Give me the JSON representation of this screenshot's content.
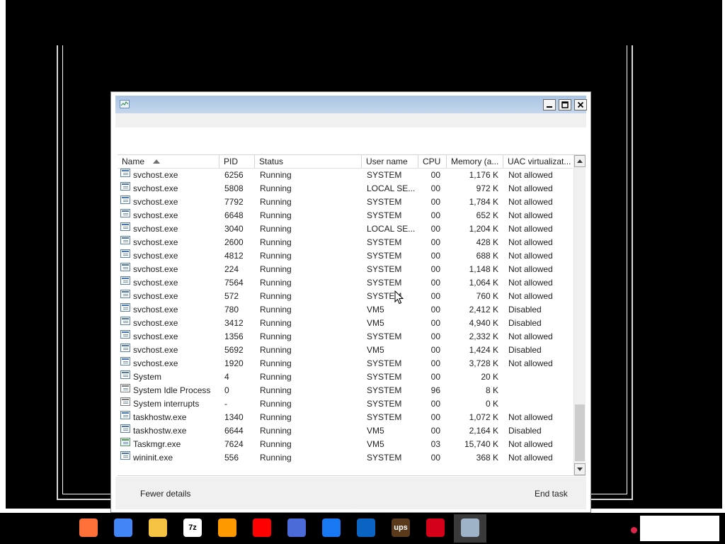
{
  "window": {
    "columns": [
      "Name",
      "PID",
      "Status",
      "User name",
      "CPU",
      "Memory (a...",
      "UAC virtualizat..."
    ],
    "rows": [
      {
        "name": "svchost.exe",
        "pid": "6256",
        "status": "Running",
        "user": "SYSTEM",
        "cpu": "00",
        "mem": "1,176 K",
        "uac": "Not allowed",
        "icon": "service-icon"
      },
      {
        "name": "svchost.exe",
        "pid": "5808",
        "status": "Running",
        "user": "LOCAL SE...",
        "cpu": "00",
        "mem": "972 K",
        "uac": "Not allowed",
        "icon": "service-icon"
      },
      {
        "name": "svchost.exe",
        "pid": "7792",
        "status": "Running",
        "user": "SYSTEM",
        "cpu": "00",
        "mem": "1,784 K",
        "uac": "Not allowed",
        "icon": "service-icon"
      },
      {
        "name": "svchost.exe",
        "pid": "6648",
        "status": "Running",
        "user": "SYSTEM",
        "cpu": "00",
        "mem": "652 K",
        "uac": "Not allowed",
        "icon": "service-icon"
      },
      {
        "name": "svchost.exe",
        "pid": "3040",
        "status": "Running",
        "user": "LOCAL SE...",
        "cpu": "00",
        "mem": "1,204 K",
        "uac": "Not allowed",
        "icon": "service-icon"
      },
      {
        "name": "svchost.exe",
        "pid": "2600",
        "status": "Running",
        "user": "SYSTEM",
        "cpu": "00",
        "mem": "428 K",
        "uac": "Not allowed",
        "icon": "service-icon"
      },
      {
        "name": "svchost.exe",
        "pid": "4812",
        "status": "Running",
        "user": "SYSTEM",
        "cpu": "00",
        "mem": "688 K",
        "uac": "Not allowed",
        "icon": "service-icon"
      },
      {
        "name": "svchost.exe",
        "pid": "224",
        "status": "Running",
        "user": "SYSTEM",
        "cpu": "00",
        "mem": "1,148 K",
        "uac": "Not allowed",
        "icon": "service-icon"
      },
      {
        "name": "svchost.exe",
        "pid": "7564",
        "status": "Running",
        "user": "SYSTEM",
        "cpu": "00",
        "mem": "1,064 K",
        "uac": "Not allowed",
        "icon": "service-icon"
      },
      {
        "name": "svchost.exe",
        "pid": "572",
        "status": "Running",
        "user": "SYSTEM",
        "cpu": "00",
        "mem": "760 K",
        "uac": "Not allowed",
        "icon": "service-icon"
      },
      {
        "name": "svchost.exe",
        "pid": "780",
        "status": "Running",
        "user": "VM5",
        "cpu": "00",
        "mem": "2,412 K",
        "uac": "Disabled",
        "icon": "service-icon"
      },
      {
        "name": "svchost.exe",
        "pid": "3412",
        "status": "Running",
        "user": "VM5",
        "cpu": "00",
        "mem": "4,940 K",
        "uac": "Disabled",
        "icon": "service-icon"
      },
      {
        "name": "svchost.exe",
        "pid": "1356",
        "status": "Running",
        "user": "SYSTEM",
        "cpu": "00",
        "mem": "2,332 K",
        "uac": "Not allowed",
        "icon": "service-icon"
      },
      {
        "name": "svchost.exe",
        "pid": "5692",
        "status": "Running",
        "user": "VM5",
        "cpu": "00",
        "mem": "1,424 K",
        "uac": "Disabled",
        "icon": "service-icon"
      },
      {
        "name": "svchost.exe",
        "pid": "1920",
        "status": "Running",
        "user": "SYSTEM",
        "cpu": "00",
        "mem": "3,728 K",
        "uac": "Not allowed",
        "icon": "service-icon"
      },
      {
        "name": "System",
        "pid": "4",
        "status": "Running",
        "user": "SYSTEM",
        "cpu": "00",
        "mem": "20 K",
        "uac": "",
        "icon": "service-icon"
      },
      {
        "name": "System Idle Process",
        "pid": "0",
        "status": "Running",
        "user": "SYSTEM",
        "cpu": "96",
        "mem": "8 K",
        "uac": "",
        "icon": "system-icon"
      },
      {
        "name": "System interrupts",
        "pid": "-",
        "status": "Running",
        "user": "SYSTEM",
        "cpu": "00",
        "mem": "0 K",
        "uac": "",
        "icon": "system-icon"
      },
      {
        "name": "taskhostw.exe",
        "pid": "1340",
        "status": "Running",
        "user": "SYSTEM",
        "cpu": "00",
        "mem": "1,072 K",
        "uac": "Not allowed",
        "icon": "service-icon"
      },
      {
        "name": "taskhostw.exe",
        "pid": "6644",
        "status": "Running",
        "user": "VM5",
        "cpu": "00",
        "mem": "2,164 K",
        "uac": "Disabled",
        "icon": "service-icon"
      },
      {
        "name": "Taskmgr.exe",
        "pid": "7624",
        "status": "Running",
        "user": "VM5",
        "cpu": "03",
        "mem": "15,740 K",
        "uac": "Not allowed",
        "icon": "task-manager-icon"
      },
      {
        "name": "wininit.exe",
        "pid": "556",
        "status": "Running",
        "user": "SYSTEM",
        "cpu": "00",
        "mem": "368 K",
        "uac": "Not allowed",
        "icon": "service-icon"
      }
    ],
    "footer": {
      "fewer_details": "Fewer details",
      "end_task": "End task"
    }
  },
  "taskbar": {
    "apps": [
      {
        "name": "firefox-icon",
        "color": "#ff7139"
      },
      {
        "name": "chrome-icon",
        "color": "#4285f4"
      },
      {
        "name": "file-explorer-icon",
        "color": "#f5c242"
      },
      {
        "name": "7zip-icon",
        "color": "#ffffff",
        "label": "7z"
      },
      {
        "name": "amazon-icon",
        "color": "#ff9900"
      },
      {
        "name": "youtube-icon",
        "color": "#ff0000"
      },
      {
        "name": "bing-icon",
        "color": "#4a6bd8"
      },
      {
        "name": "facebook-icon",
        "color": "#1877f2"
      },
      {
        "name": "outlook-icon",
        "color": "#0a64c2"
      },
      {
        "name": "ups-icon",
        "color": "#5a3a1a",
        "label": "ups"
      },
      {
        "name": "bank-of-america-icon",
        "color": "#d4001a"
      },
      {
        "name": "task-manager-icon",
        "color": "#9fb3c8"
      }
    ]
  }
}
